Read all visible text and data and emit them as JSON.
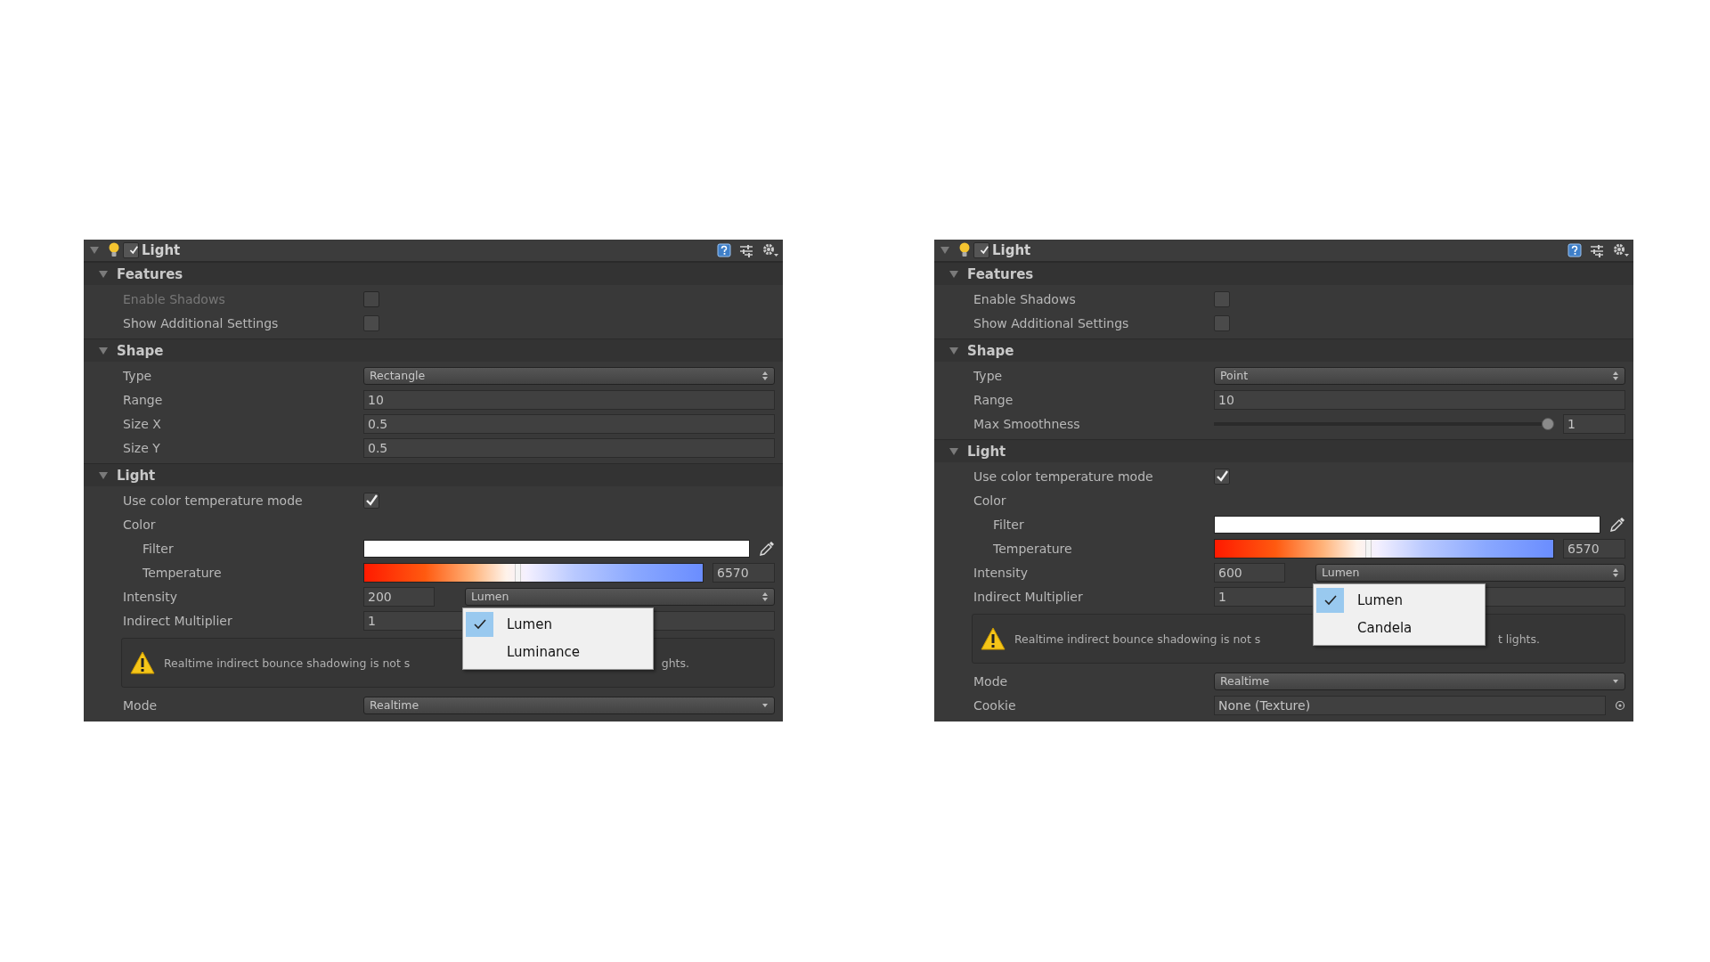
{
  "panels": [
    {
      "component": {
        "title": "Light",
        "enabled": true,
        "expanded": true
      },
      "sections": [
        {
          "title": "Features",
          "expanded": true,
          "rows": [
            {
              "kind": "checkbox",
              "label": "Enable Shadows",
              "checked": false,
              "disabled": true
            },
            {
              "kind": "checkbox",
              "label": "Show Additional Settings",
              "checked": false,
              "disabled": false
            }
          ]
        },
        {
          "title": "Shape",
          "expanded": true,
          "rows": [
            {
              "kind": "popup",
              "label": "Type",
              "value": "Rectangle"
            },
            {
              "kind": "field",
              "label": "Range",
              "value": "10"
            },
            {
              "kind": "field",
              "label": "Size X",
              "value": "0.5"
            },
            {
              "kind": "field",
              "label": "Size Y",
              "value": "0.5"
            }
          ]
        },
        {
          "title": "Light",
          "expanded": true,
          "rows": [
            {
              "kind": "checkbox",
              "label": "Use color temperature mode",
              "checked": true
            },
            {
              "kind": "group",
              "label": "Color",
              "children": [
                {
                  "kind": "color",
                  "label": "Filter",
                  "color": "#ffffff"
                },
                {
                  "kind": "temperature",
                  "label": "Temperature",
                  "level": 0.45,
                  "value": "6570"
                }
              ]
            },
            {
              "kind": "intensity",
              "label": "Intensity",
              "value": "200",
              "unit": "Lumen",
              "menu": {
                "open": true,
                "options": [
                  {
                    "label": "Lumen",
                    "selected": true
                  },
                  {
                    "label": "Luminance",
                    "selected": false
                  }
                ]
              }
            },
            {
              "kind": "field",
              "label": "Indirect Multiplier",
              "value": "1"
            },
            {
              "kind": "helpbox",
              "text_before": "Realtime indirect bounce shadowing is not s",
              "text_after": "ghts."
            },
            {
              "kind": "enum",
              "label": "Mode",
              "value": "Realtime"
            }
          ]
        }
      ]
    },
    {
      "component": {
        "title": "Light",
        "enabled": true,
        "expanded": true
      },
      "sections": [
        {
          "title": "Features",
          "expanded": true,
          "rows": [
            {
              "kind": "checkbox",
              "label": "Enable Shadows",
              "checked": false,
              "disabled": false
            },
            {
              "kind": "checkbox",
              "label": "Show Additional Settings",
              "checked": false,
              "disabled": false
            }
          ]
        },
        {
          "title": "Shape",
          "expanded": true,
          "rows": [
            {
              "kind": "popup",
              "label": "Type",
              "value": "Point"
            },
            {
              "kind": "field",
              "label": "Range",
              "value": "10"
            },
            {
              "kind": "slider",
              "label": "Max Smoothness",
              "level": 1,
              "value": "1"
            }
          ]
        },
        {
          "title": "Light",
          "expanded": true,
          "rows": [
            {
              "kind": "checkbox",
              "label": "Use color temperature mode",
              "checked": true
            },
            {
              "kind": "group",
              "label": "Color",
              "children": [
                {
                  "kind": "color",
                  "label": "Filter",
                  "color": "#ffffff"
                },
                {
                  "kind": "temperature",
                  "label": "Temperature",
                  "level": 0.45,
                  "value": "6570"
                }
              ]
            },
            {
              "kind": "intensity",
              "label": "Intensity",
              "value": "600",
              "unit": "Lumen",
              "menu": {
                "open": true,
                "options": [
                  {
                    "label": "Lumen",
                    "selected": true
                  },
                  {
                    "label": "Candela",
                    "selected": false
                  }
                ]
              }
            },
            {
              "kind": "field",
              "label": "Indirect Multiplier",
              "value": "1"
            },
            {
              "kind": "helpbox",
              "text_before": "Realtime indirect bounce shadowing is not s",
              "text_after": "t lights."
            },
            {
              "kind": "enum",
              "label": "Mode",
              "value": "Realtime"
            },
            {
              "kind": "object",
              "label": "Cookie",
              "value": "None (Texture)"
            }
          ]
        }
      ]
    }
  ]
}
